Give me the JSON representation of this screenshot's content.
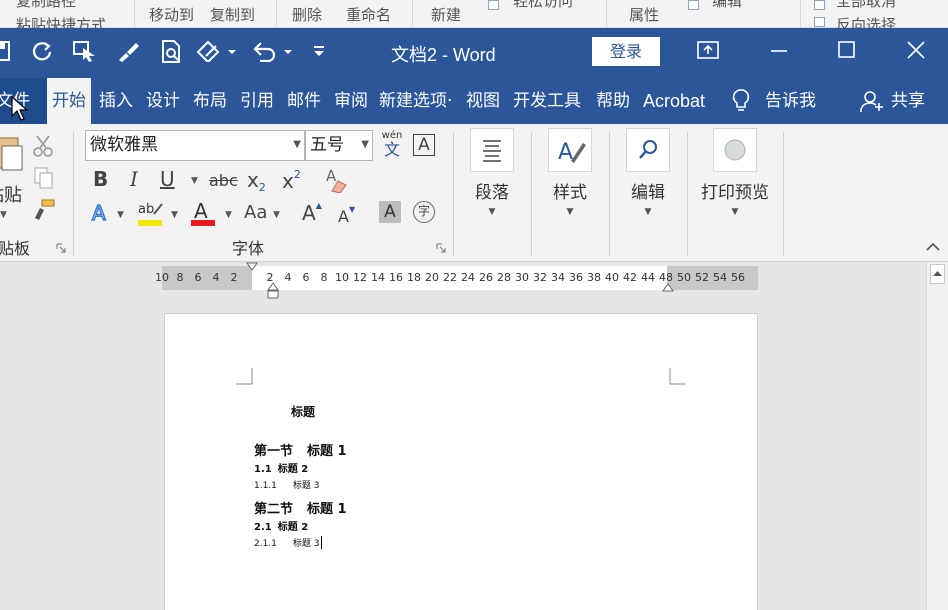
{
  "background_strip": {
    "items": [
      "复制路径",
      "粘贴快捷方式",
      "移动到",
      "复制到",
      "删除",
      "重命名",
      "新建",
      "轻松访问",
      "属性",
      "编辑",
      "全部取消",
      "反向选择"
    ]
  },
  "window": {
    "title": "文档2  -  Word",
    "login_label": "登录"
  },
  "tabs": [
    {
      "label": "文件"
    },
    {
      "label": "开始"
    },
    {
      "label": "插入"
    },
    {
      "label": "设计"
    },
    {
      "label": "布局"
    },
    {
      "label": "引用"
    },
    {
      "label": "邮件"
    },
    {
      "label": "审阅"
    },
    {
      "label": "新建选项·"
    },
    {
      "label": "视图"
    },
    {
      "label": "开发工具"
    },
    {
      "label": "帮助"
    },
    {
      "label": "Acrobat"
    },
    {
      "label": "告诉我"
    },
    {
      "label": "共享"
    }
  ],
  "ribbon": {
    "clipboard": {
      "paste_label": "粘贴",
      "group_label": "剪贴板"
    },
    "font": {
      "font_name": "微软雅黑",
      "font_size": "五号",
      "wen_top": "wén",
      "wen_bottom": "文",
      "bordered_a": "A",
      "bold": "B",
      "italic": "I",
      "underline": "U",
      "strike": "abc",
      "subscript_base": "x",
      "subscript_mark": "2",
      "superscript_base": "x",
      "superscript_mark": "2",
      "text_effect": "A",
      "font_color": "A",
      "change_case": "Aa",
      "grow": "A",
      "shrink": "A",
      "shading": "A",
      "enclose": "字",
      "group_label": "字体"
    },
    "paragraph": {
      "label": "段落"
    },
    "styles": {
      "label": "样式"
    },
    "editing": {
      "label": "编辑"
    },
    "print_preview": {
      "label": "打印预览"
    },
    "colors": {
      "accent": "#2b579a",
      "highlight": "#f5e600",
      "font_color": "#e81c1c"
    }
  },
  "ruler": {
    "left_numbers": [
      "10",
      "8",
      "6",
      "4",
      "2"
    ],
    "right_numbers": [
      "2",
      "4",
      "6",
      "8",
      "10",
      "12",
      "14",
      "16",
      "18",
      "20",
      "22",
      "24",
      "26",
      "28",
      "30",
      "32",
      "34",
      "36",
      "38",
      "40",
      "42",
      "44",
      "48",
      "50",
      "52",
      "54",
      "56"
    ]
  },
  "document": {
    "title": "标题",
    "sections": [
      {
        "h1_num": "第一节",
        "h1": "标题 1",
        "h2_num": "1.1",
        "h2": "标题 2",
        "h3_num": "1.1.1",
        "h3": "标题 3"
      },
      {
        "h1_num": "第二节",
        "h1": "标题 1",
        "h2_num": "2.1",
        "h2": "标题 2",
        "h3_num": "2.1.1",
        "h3": "标题 3"
      }
    ]
  }
}
